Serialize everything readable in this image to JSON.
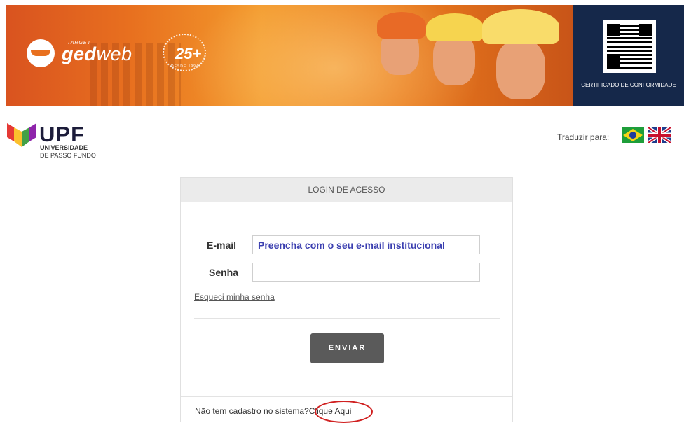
{
  "banner": {
    "brand_small": "TARGET",
    "brand_main": "ged",
    "brand_web": "web",
    "anniversary_number": "25+",
    "anniversary_sub": "DESDE 1994",
    "certificate_label": "CERTIFICADO DE CONFORMIDADE"
  },
  "institution": {
    "acronym": "UPF",
    "line1": "UNIVERSIDADE",
    "line2": "DE PASSO FUNDO"
  },
  "translate": {
    "label": "Traduzir para:"
  },
  "login": {
    "header": "LOGIN DE ACESSO",
    "email_label": "E-mail",
    "email_placeholder": "Preencha com o seu e-mail institucional",
    "password_label": "Senha",
    "password_value": "",
    "forgot_link": "Esqueci minha senha",
    "submit_label": "ENVIAR",
    "no_account_text": "Não tem cadastro no sistema?",
    "register_link": "Clique Aqui"
  },
  "colors": {
    "banner_orange": "#e8701f",
    "cert_navy": "#15284a",
    "button_gray": "#5a5a5a",
    "placeholder_blue": "#3b3fb0",
    "highlight_red": "#d02020"
  }
}
